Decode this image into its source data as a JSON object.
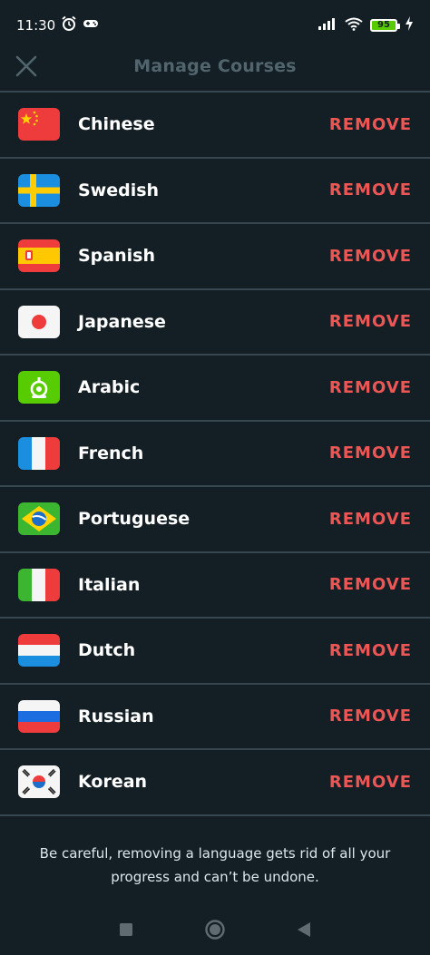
{
  "status_bar": {
    "time": "11:30",
    "battery": "95"
  },
  "header": {
    "title": "Manage Courses",
    "close_icon": "close-icon"
  },
  "courses": [
    {
      "name": "Chinese",
      "action": "REMOVE",
      "flag": "china-flag-icon"
    },
    {
      "name": "Swedish",
      "action": "REMOVE",
      "flag": "sweden-flag-icon"
    },
    {
      "name": "Spanish",
      "action": "REMOVE",
      "flag": "spain-flag-icon"
    },
    {
      "name": "Japanese",
      "action": "REMOVE",
      "flag": "japan-flag-icon"
    },
    {
      "name": "Arabic",
      "action": "REMOVE",
      "flag": "arabic-flag-icon"
    },
    {
      "name": "French",
      "action": "REMOVE",
      "flag": "france-flag-icon"
    },
    {
      "name": "Portuguese",
      "action": "REMOVE",
      "flag": "brazil-flag-icon"
    },
    {
      "name": "Italian",
      "action": "REMOVE",
      "flag": "italy-flag-icon"
    },
    {
      "name": "Dutch",
      "action": "REMOVE",
      "flag": "netherlands-flag-icon"
    },
    {
      "name": "Russian",
      "action": "REMOVE",
      "flag": "russia-flag-icon"
    },
    {
      "name": "Korean",
      "action": "REMOVE",
      "flag": "korea-flag-icon"
    }
  ],
  "warning": {
    "line1": "Be careful, removing a language gets rid of all your",
    "line2": "progress and can’t be undone."
  },
  "colors": {
    "background": "#131f24",
    "divider": "#37464f",
    "remove": "#ee5555",
    "title": "#52656d",
    "battery": "#58cc02"
  }
}
